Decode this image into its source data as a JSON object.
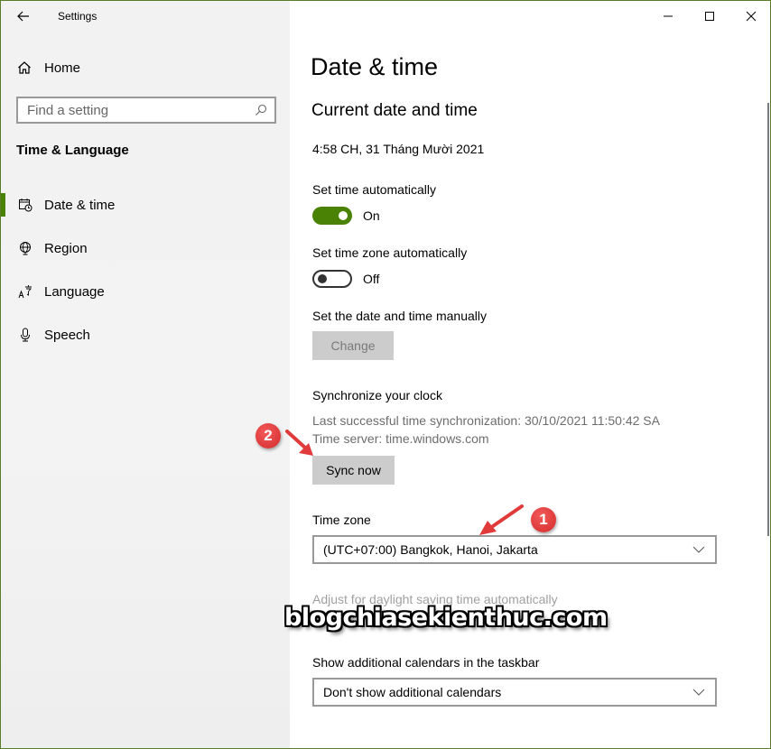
{
  "window": {
    "title": "Settings",
    "controls": {
      "minimize": "minimize",
      "maximize": "maximize",
      "close": "close"
    },
    "accent_color": "#498205"
  },
  "sidebar": {
    "home_label": "Home",
    "search_placeholder": "Find a setting",
    "section_title": "Time & Language",
    "items": [
      {
        "label": "Date & time",
        "icon": "calendar-clock-icon",
        "active": true
      },
      {
        "label": "Region",
        "icon": "globe-icon",
        "active": false
      },
      {
        "label": "Language",
        "icon": "language-icon",
        "active": false
      },
      {
        "label": "Speech",
        "icon": "microphone-icon",
        "active": false
      }
    ]
  },
  "main": {
    "page_title": "Date & time",
    "subtitle": "Current date and time",
    "current_time": "4:58 CH, 31 Tháng Mười 2021",
    "set_time_auto": {
      "label": "Set time automatically",
      "state": "On",
      "on": true
    },
    "set_timezone_auto": {
      "label": "Set time zone automatically",
      "state": "Off",
      "on": false
    },
    "manual": {
      "label": "Set the date and time manually",
      "button": "Change",
      "disabled": true
    },
    "sync": {
      "label": "Synchronize your clock",
      "last_sync": "Last successful time synchronization: 30/10/2021 11:50:42 SA",
      "server": "Time server: time.windows.com",
      "button": "Sync now"
    },
    "timezone": {
      "label": "Time zone",
      "value": "(UTC+07:00) Bangkok, Hanoi, Jakarta"
    },
    "daylight": {
      "label": "Adjust for daylight saving time automatically",
      "disabled": true
    },
    "calendars": {
      "label": "Show additional calendars in the taskbar",
      "value": "Don't show additional calendars"
    }
  },
  "annotations": {
    "badge_1": "1",
    "badge_2": "2",
    "color": "#e03a3a",
    "watermark": "blogchiasekienthuc.com"
  }
}
